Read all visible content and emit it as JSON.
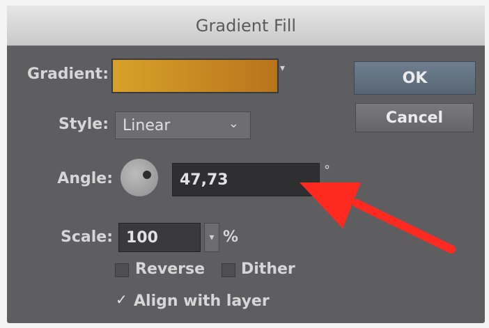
{
  "dialog": {
    "title": "Gradient Fill",
    "gradient_label": "Gradient:",
    "style_label": "Style:",
    "style_value": "Linear",
    "angle_label": "Angle:",
    "angle_value": "47,73",
    "angle_unit": "°",
    "scale_label": "Scale:",
    "scale_value": "100",
    "scale_unit": "%",
    "reverse_label": "Reverse",
    "reverse_checked": false,
    "dither_label": "Dither",
    "dither_checked": false,
    "align_label": "Align with layer",
    "align_checked": true,
    "ok_label": "OK",
    "cancel_label": "Cancel"
  },
  "colors": {
    "gradient_start": "#d8a12a",
    "gradient_end": "#b8741c",
    "annotation_arrow": "#ff2a1f"
  },
  "icons": {
    "dropdown": "chevron-down-icon",
    "gradient_menu": "triangle-down-icon",
    "angle_dial": "angle-dial-icon",
    "annotation": "red-arrow-icon"
  }
}
